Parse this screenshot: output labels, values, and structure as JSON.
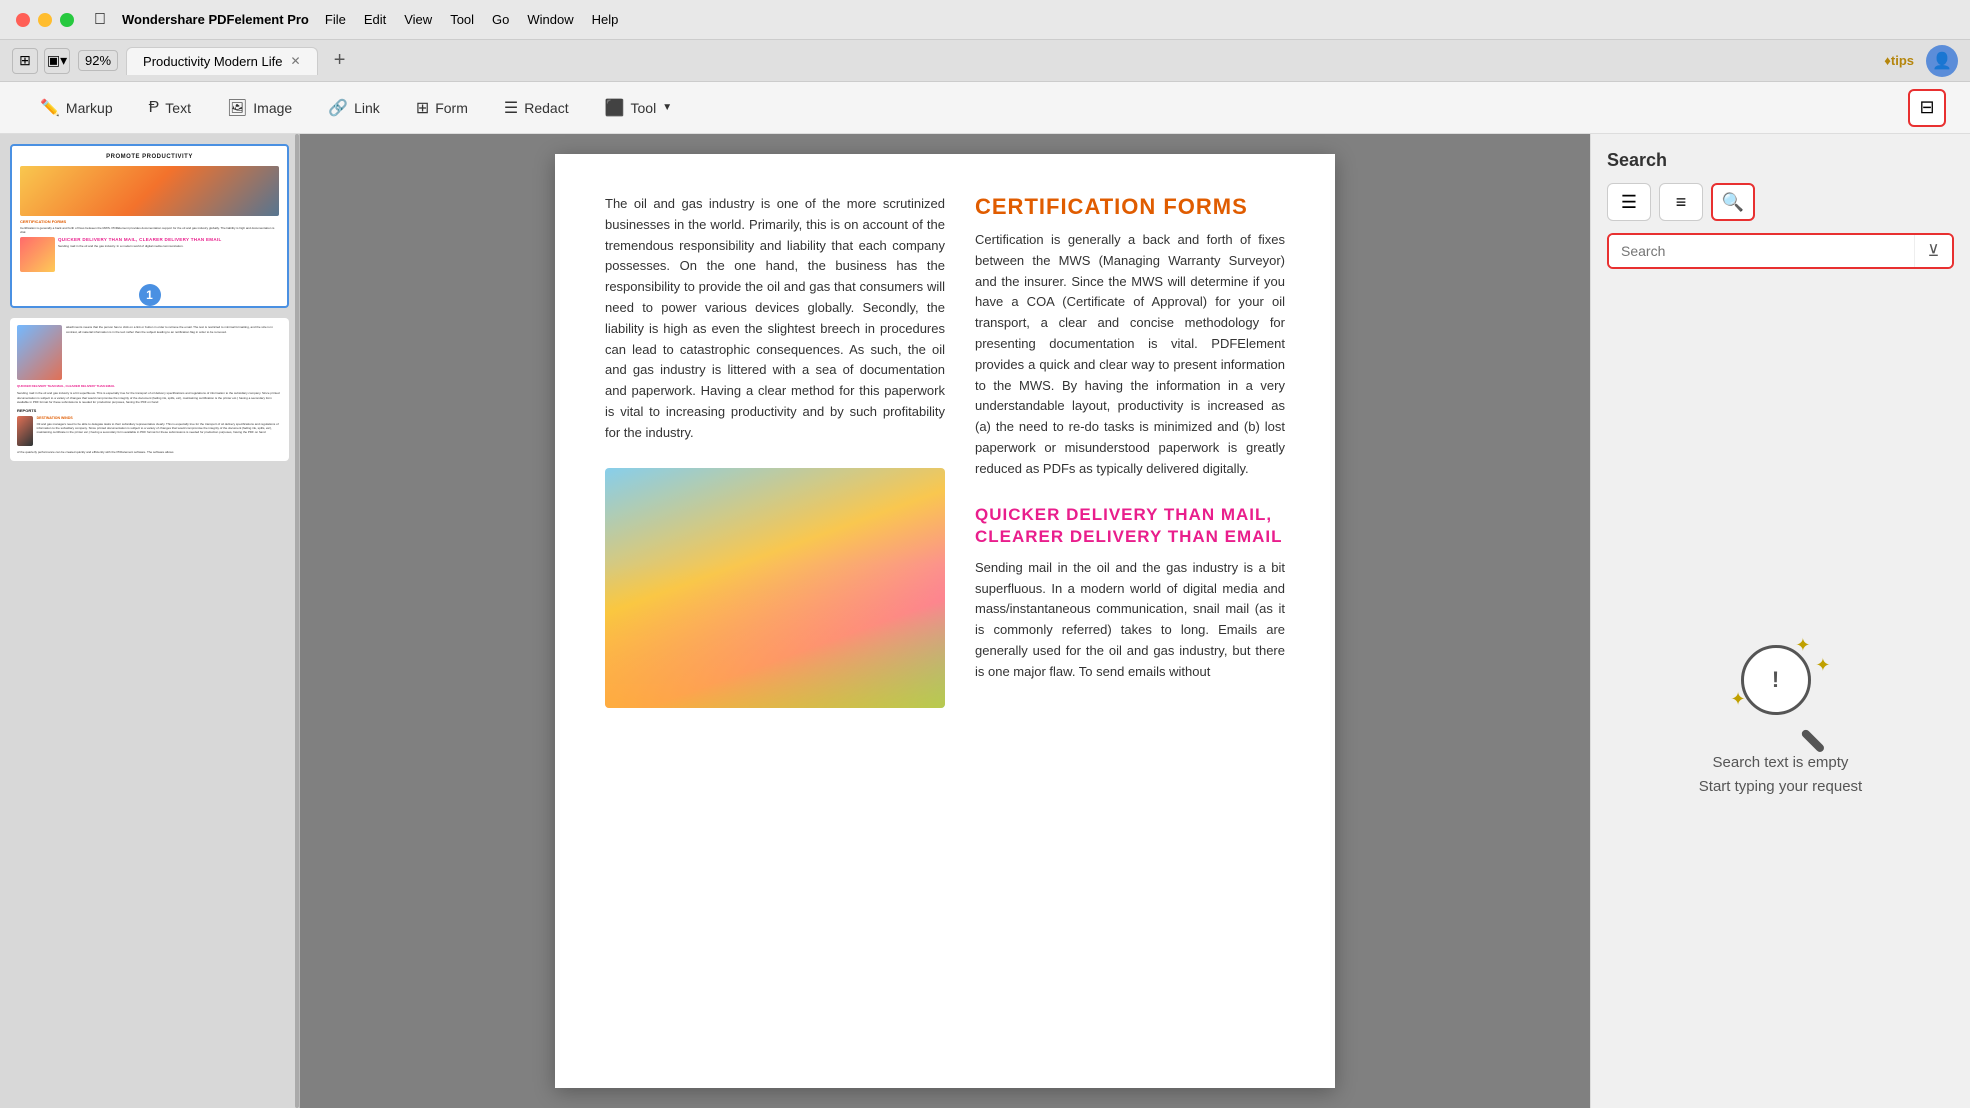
{
  "titlebar": {
    "app_name": "Wondershare PDFelement Pro",
    "menu": [
      "File",
      "Edit",
      "View",
      "Tool",
      "Go",
      "Window",
      "Help"
    ]
  },
  "tabbar": {
    "tab_title": "Productivity Modern Life",
    "zoom": "92%",
    "add_tab": "+"
  },
  "toolbar": {
    "markup": "Markup",
    "text": "Text",
    "image": "Image",
    "link": "Link",
    "form": "Form",
    "redact": "Redact",
    "tool": "Tool"
  },
  "sidebar": {
    "page1_num": "1",
    "page1_title": "PROMOTE PRODUCTIVITY",
    "page1_cert": "CERTIFICATION FORMS",
    "page1_pink": "QUICKER DELIVERY THAN MAIL, CLEARER DELIVERY THAN EMAIL"
  },
  "document": {
    "body_left": "The oil and gas industry is one of the more scrutinized businesses in the world. Primarily, this is on account of the tremendous responsibility and liability that each company possesses. On the one hand, the business has the responsibility to provide the oil and gas that consumers will need to power various devices globally. Secondly, the liability is high as even the slightest breech in procedures can lead to catastrophic consequences. As such, the oil and gas industry is littered with a sea of documentation and paperwork. Having a clear method for this paperwork is vital to increasing productivity and by such profitability for the industry.",
    "cert_heading": "CERTIFICATION FORMS",
    "cert_body": "Certification is generally a back and forth of fixes between the MWS (Managing Warranty Surveyor) and the insurer. Since the MWS will determine if you have a COA (Certificate of Approval) for your oil transport, a clear and concise methodology for presenting documentation is vital. PDFElement provides a quick and clear way to present information to the MWS. By having the information in a very understandable layout, productivity is increased as (a) the need to re-do tasks is minimized and (b) lost paperwork or misunderstood paperwork is greatly reduced as PDFs as typically delivered digitally.",
    "delivery_heading": "QUICKER DELIVERY THAN MAIL, CLEARER DELIVERY THAN EMAIL",
    "delivery_body": "Sending mail in the oil and the gas industry is a bit superfluous. In a modern world of digital media and mass/instantaneous communication, snail mail (as it is commonly referred) takes to long. Emails are generally used for the oil and gas industry, but there is one major flaw. To send emails without"
  },
  "search": {
    "title": "Search",
    "placeholder": "Search",
    "empty_line1": "Search text is empty",
    "empty_line2": "Start typing your request",
    "icon_type1": "☰",
    "icon_type2": "≡",
    "icon_search": "🔍",
    "icon_filter": "⊻"
  }
}
